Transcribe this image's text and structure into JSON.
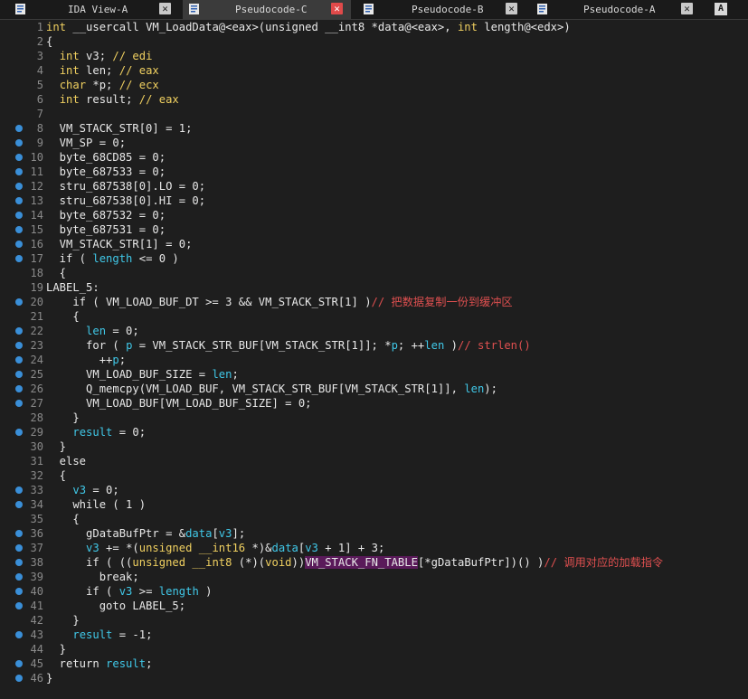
{
  "tabs": [
    {
      "label": "IDA View-A",
      "active": false,
      "icon": "text-view-icon"
    },
    {
      "label": "Pseudocode-C",
      "active": true,
      "icon": "pseudocode-icon"
    },
    {
      "label": "Pseudocode-B",
      "active": false,
      "icon": "pseudocode-icon"
    },
    {
      "label": "Pseudocode-A",
      "active": false,
      "icon": "pseudocode-icon"
    }
  ],
  "right_button": "A",
  "colors": {
    "background": "#1e1e1e",
    "keyword": "#e8e8e8",
    "type": "#f0d060",
    "variable": "#40c8e8",
    "comment": "#e05050",
    "breakpoint": "#3a8fd8",
    "highlight": "#5a1a5a"
  },
  "lines": [
    {
      "n": "1",
      "bp": false,
      "tokens": [
        [
          "ty",
          "int "
        ],
        [
          "kw",
          "__usercall VM_LoadData@<eax>(unsigned __int8 *data@<eax>, "
        ],
        [
          "ty",
          "int "
        ],
        [
          "kw",
          "length@<edx>)"
        ]
      ]
    },
    {
      "n": "2",
      "bp": false,
      "tokens": [
        [
          "kw",
          "{"
        ]
      ]
    },
    {
      "n": "3",
      "bp": false,
      "tokens": [
        [
          "kw",
          "  "
        ],
        [
          "ty",
          "int "
        ],
        [
          "kw",
          "v3; "
        ],
        [
          "ty",
          "// edi"
        ]
      ]
    },
    {
      "n": "4",
      "bp": false,
      "tokens": [
        [
          "kw",
          "  "
        ],
        [
          "ty",
          "int "
        ],
        [
          "kw",
          "len; "
        ],
        [
          "ty",
          "// eax"
        ]
      ]
    },
    {
      "n": "5",
      "bp": false,
      "tokens": [
        [
          "kw",
          "  "
        ],
        [
          "ty",
          "char "
        ],
        [
          "kw",
          "*p; "
        ],
        [
          "ty",
          "// ecx"
        ]
      ]
    },
    {
      "n": "6",
      "bp": false,
      "tokens": [
        [
          "kw",
          "  "
        ],
        [
          "ty",
          "int "
        ],
        [
          "kw",
          "result; "
        ],
        [
          "ty",
          "// eax"
        ]
      ]
    },
    {
      "n": "7",
      "bp": false,
      "tokens": [
        [
          "kw",
          ""
        ]
      ]
    },
    {
      "n": "8",
      "bp": true,
      "tokens": [
        [
          "kw",
          "  VM_STACK_STR[0] = 1;"
        ]
      ]
    },
    {
      "n": "9",
      "bp": true,
      "tokens": [
        [
          "kw",
          "  VM_SP = 0;"
        ]
      ]
    },
    {
      "n": "10",
      "bp": true,
      "tokens": [
        [
          "kw",
          "  byte_68CD85 = 0;"
        ]
      ]
    },
    {
      "n": "11",
      "bp": true,
      "tokens": [
        [
          "kw",
          "  byte_687533 = 0;"
        ]
      ]
    },
    {
      "n": "12",
      "bp": true,
      "tokens": [
        [
          "kw",
          "  stru_687538[0].LO = 0;"
        ]
      ]
    },
    {
      "n": "13",
      "bp": true,
      "tokens": [
        [
          "kw",
          "  stru_687538[0].HI = 0;"
        ]
      ]
    },
    {
      "n": "14",
      "bp": true,
      "tokens": [
        [
          "kw",
          "  byte_687532 = 0;"
        ]
      ]
    },
    {
      "n": "15",
      "bp": true,
      "tokens": [
        [
          "kw",
          "  byte_687531 = 0;"
        ]
      ]
    },
    {
      "n": "16",
      "bp": true,
      "tokens": [
        [
          "kw",
          "  VM_STACK_STR[1] = 0;"
        ]
      ]
    },
    {
      "n": "17",
      "bp": true,
      "tokens": [
        [
          "kw",
          "  if ( "
        ],
        [
          "var",
          "length"
        ],
        [
          "kw",
          " <= 0 )"
        ]
      ]
    },
    {
      "n": "18",
      "bp": false,
      "tokens": [
        [
          "kw",
          "  {"
        ]
      ]
    },
    {
      "n": "19",
      "bp": false,
      "tokens": [
        [
          "kw",
          "LABEL_5:"
        ]
      ]
    },
    {
      "n": "20",
      "bp": true,
      "tokens": [
        [
          "kw",
          "    if ( VM_LOAD_BUF_DT >= 3 && VM_STACK_STR[1] )"
        ],
        [
          "cm",
          "// 把数据复制一份到缓冲区"
        ]
      ]
    },
    {
      "n": "21",
      "bp": false,
      "tokens": [
        [
          "kw",
          "    {"
        ]
      ]
    },
    {
      "n": "22",
      "bp": true,
      "tokens": [
        [
          "kw",
          "      "
        ],
        [
          "var",
          "len"
        ],
        [
          "kw",
          " = 0;"
        ]
      ]
    },
    {
      "n": "23",
      "bp": true,
      "tokens": [
        [
          "kw",
          "      for ( "
        ],
        [
          "var",
          "p"
        ],
        [
          "kw",
          " = VM_STACK_STR_BUF[VM_STACK_STR[1]]; *"
        ],
        [
          "var",
          "p"
        ],
        [
          "kw",
          "; ++"
        ],
        [
          "var",
          "len"
        ],
        [
          "kw",
          " )"
        ],
        [
          "cm",
          "// strlen()"
        ]
      ]
    },
    {
      "n": "24",
      "bp": true,
      "tokens": [
        [
          "kw",
          "        ++"
        ],
        [
          "var",
          "p"
        ],
        [
          "kw",
          ";"
        ]
      ]
    },
    {
      "n": "25",
      "bp": true,
      "tokens": [
        [
          "kw",
          "      VM_LOAD_BUF_SIZE = "
        ],
        [
          "var",
          "len"
        ],
        [
          "kw",
          ";"
        ]
      ]
    },
    {
      "n": "26",
      "bp": true,
      "tokens": [
        [
          "kw",
          "      Q_memcpy(VM_LOAD_BUF, VM_STACK_STR_BUF[VM_STACK_STR[1]], "
        ],
        [
          "var",
          "len"
        ],
        [
          "kw",
          ");"
        ]
      ]
    },
    {
      "n": "27",
      "bp": true,
      "tokens": [
        [
          "kw",
          "      VM_LOAD_BUF[VM_LOAD_BUF_SIZE] = 0;"
        ]
      ]
    },
    {
      "n": "28",
      "bp": false,
      "tokens": [
        [
          "kw",
          "    }"
        ]
      ]
    },
    {
      "n": "29",
      "bp": true,
      "tokens": [
        [
          "kw",
          "    "
        ],
        [
          "var",
          "result"
        ],
        [
          "kw",
          " = 0;"
        ]
      ]
    },
    {
      "n": "30",
      "bp": false,
      "tokens": [
        [
          "kw",
          "  }"
        ]
      ]
    },
    {
      "n": "31",
      "bp": false,
      "tokens": [
        [
          "kw",
          "  else"
        ]
      ]
    },
    {
      "n": "32",
      "bp": false,
      "tokens": [
        [
          "kw",
          "  {"
        ]
      ]
    },
    {
      "n": "33",
      "bp": true,
      "tokens": [
        [
          "kw",
          "    "
        ],
        [
          "var",
          "v3"
        ],
        [
          "kw",
          " = 0;"
        ]
      ]
    },
    {
      "n": "34",
      "bp": true,
      "tokens": [
        [
          "kw",
          "    while ( 1 )"
        ]
      ]
    },
    {
      "n": "35",
      "bp": false,
      "tokens": [
        [
          "kw",
          "    {"
        ]
      ]
    },
    {
      "n": "36",
      "bp": true,
      "tokens": [
        [
          "kw",
          "      gDataBufPtr = &"
        ],
        [
          "var",
          "data"
        ],
        [
          "kw",
          "["
        ],
        [
          "var",
          "v3"
        ],
        [
          "kw",
          "];"
        ]
      ]
    },
    {
      "n": "37",
      "bp": true,
      "tokens": [
        [
          "kw",
          "      "
        ],
        [
          "var",
          "v3"
        ],
        [
          "kw",
          " += *("
        ],
        [
          "ty",
          "unsigned __int16 "
        ],
        [
          "kw",
          "*)&"
        ],
        [
          "var",
          "data"
        ],
        [
          "kw",
          "["
        ],
        [
          "var",
          "v3"
        ],
        [
          "kw",
          " + 1] + 3;"
        ]
      ]
    },
    {
      "n": "38",
      "bp": true,
      "tokens": [
        [
          "kw",
          "      if ( (("
        ],
        [
          "ty",
          "unsigned __int8 "
        ],
        [
          "kw",
          "(*)("
        ],
        [
          "ty",
          "void"
        ],
        [
          "kw",
          "))"
        ],
        [
          "hl",
          "VM_STACK_FN_TABLE"
        ],
        [
          "kw",
          "[*gDataBufPtr])() )"
        ],
        [
          "cm",
          "// 调用对应的加载指令"
        ]
      ]
    },
    {
      "n": "39",
      "bp": true,
      "tokens": [
        [
          "kw",
          "        break;"
        ]
      ]
    },
    {
      "n": "40",
      "bp": true,
      "tokens": [
        [
          "kw",
          "      if ( "
        ],
        [
          "var",
          "v3"
        ],
        [
          "kw",
          " >= "
        ],
        [
          "var",
          "length"
        ],
        [
          "kw",
          " )"
        ]
      ]
    },
    {
      "n": "41",
      "bp": true,
      "tokens": [
        [
          "kw",
          "        goto LABEL_5;"
        ]
      ]
    },
    {
      "n": "42",
      "bp": false,
      "tokens": [
        [
          "kw",
          "    }"
        ]
      ]
    },
    {
      "n": "43",
      "bp": true,
      "tokens": [
        [
          "kw",
          "    "
        ],
        [
          "var",
          "result"
        ],
        [
          "kw",
          " = -1;"
        ]
      ]
    },
    {
      "n": "44",
      "bp": false,
      "tokens": [
        [
          "kw",
          "  }"
        ]
      ]
    },
    {
      "n": "45",
      "bp": true,
      "tokens": [
        [
          "kw",
          "  return "
        ],
        [
          "var",
          "result"
        ],
        [
          "kw",
          ";"
        ]
      ]
    },
    {
      "n": "46",
      "bp": true,
      "tokens": [
        [
          "kw",
          "}"
        ]
      ]
    }
  ]
}
